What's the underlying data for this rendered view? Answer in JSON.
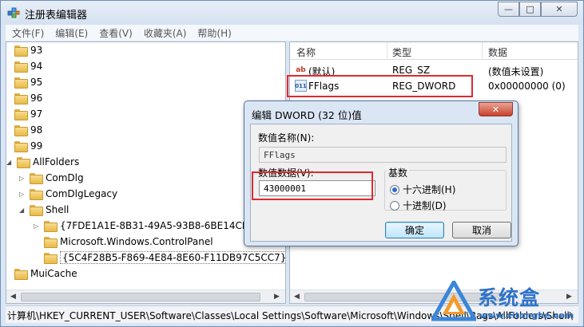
{
  "window": {
    "title": "注册表编辑器",
    "controls": {
      "minimize": "—",
      "maximize": "□",
      "close": "✕"
    }
  },
  "menu": [
    "文件(F)",
    "编辑(E)",
    "查看(V)",
    "收藏夹(A)",
    "帮助(H)"
  ],
  "tree": [
    {
      "label": "93"
    },
    {
      "label": "94"
    },
    {
      "label": "95"
    },
    {
      "label": "96"
    },
    {
      "label": "97"
    },
    {
      "label": "98"
    },
    {
      "label": "99"
    },
    {
      "label": "AllFolders"
    },
    {
      "label": "ComDlg"
    },
    {
      "label": "ComDlgLegacy"
    },
    {
      "label": "Shell"
    },
    {
      "label": "{7FDE1A1E-8B31-49A5-93B8-6BE14CFA4"
    },
    {
      "label": "Microsoft.Windows.ControlPanel"
    },
    {
      "label": "{5C4F28B5-F869-4E84-8E60-F11DB97C5CC7}"
    },
    {
      "label": "MuiCache"
    }
  ],
  "list": {
    "columns": {
      "name": "名称",
      "type": "类型",
      "data": "数据"
    },
    "rows": [
      {
        "icon": "ab",
        "name": "(默认)",
        "type": "REG_SZ",
        "data": "(数值未设置)"
      },
      {
        "icon": "011",
        "name": "FFlags",
        "type": "REG_DWORD",
        "data": "0x00000000 (0)"
      }
    ]
  },
  "statusbar": {
    "path": "计算机\\HKEY_CURRENT_USER\\Software\\Classes\\Local Settings\\Software\\Microsoft\\Windows\\Shell\\Bags\\AllFolders\\Shell\\"
  },
  "dialog": {
    "title": "编辑 DWORD (32 位)值",
    "close": "✕",
    "name_label": "数值名称(N):",
    "name_value": "FFlags",
    "data_label": "数值数据(V):",
    "data_value": "43000001",
    "base_label": "基数",
    "hex_label": "十六进制(H)",
    "dec_label": "十进制(D)",
    "ok": "确定",
    "cancel": "取消"
  },
  "watermark": {
    "text": "系统盒",
    "url": "www.xitonghe.com"
  },
  "colors": {
    "highlight_box": "#e0292f",
    "watermark": "#2f73c9"
  }
}
